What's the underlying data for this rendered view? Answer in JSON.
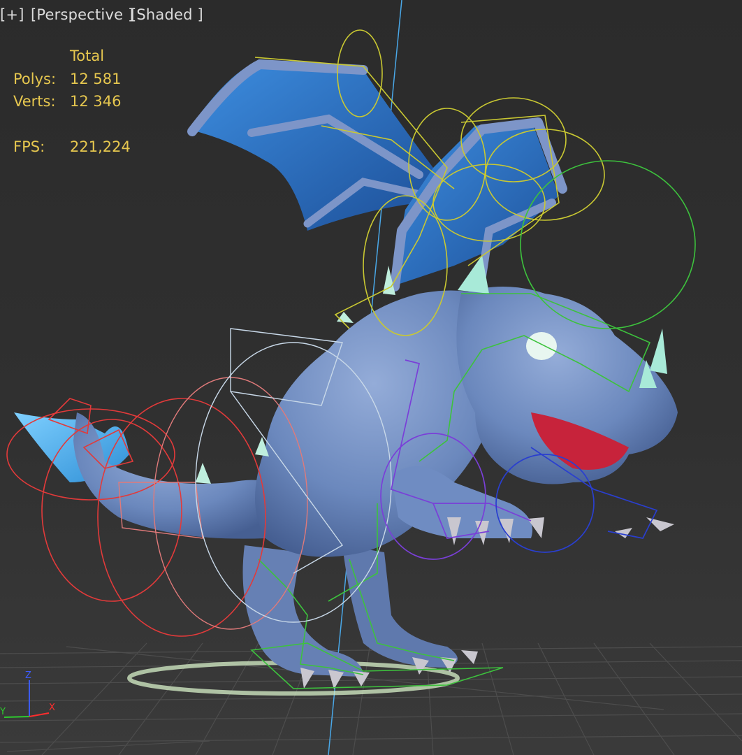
{
  "viewport": {
    "menu_plus": "[+]",
    "view_name": "[Perspective ]",
    "shading": "[Shaded ]"
  },
  "stats": {
    "total_header": "Total",
    "polys_label": "Polys:",
    "polys_value": "12 581",
    "verts_label": "Verts:",
    "verts_value": "12 346",
    "fps_label": "FPS:",
    "fps_value": "221,224"
  },
  "axis_gizmo": {
    "z": "Z",
    "y": "Y",
    "x": "X"
  },
  "colors": {
    "stats_text": "#e6c74f",
    "label_text": "#dcdcdc",
    "dragon_body": "#6f8fc4",
    "wing_membrane": "#2f75c9",
    "rig_yellow": "#c9c832",
    "rig_green": "#3dc23d",
    "rig_red": "#e23a3a",
    "rig_purple": "#7a3fd8",
    "rig_blue": "#2a3fcf",
    "rig_white": "#c8d8e8"
  }
}
